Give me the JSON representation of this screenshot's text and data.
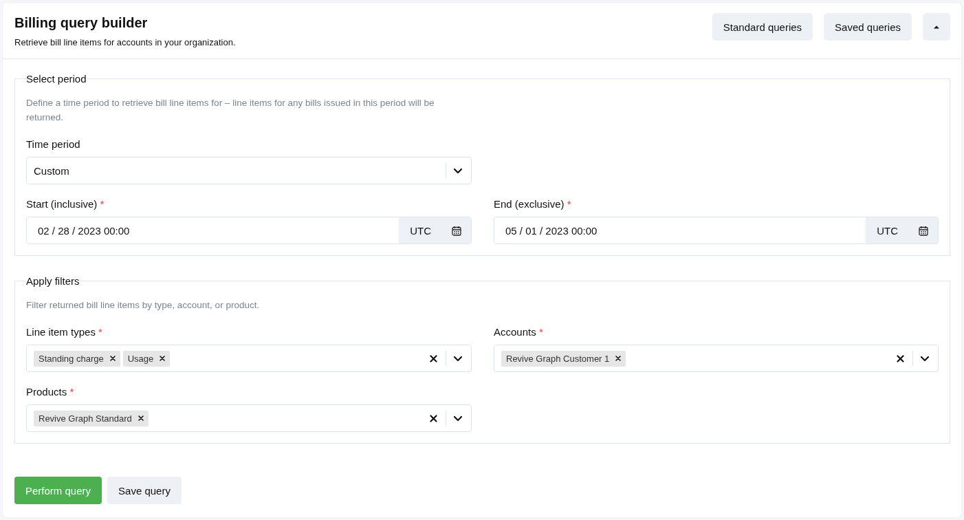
{
  "header": {
    "title": "Billing query builder",
    "subtitle": "Retrieve bill line items for accounts in your organization.",
    "buttons": [
      "Standard queries",
      "Saved queries"
    ]
  },
  "period": {
    "legend": "Select period",
    "description": "Define a time period to retrieve bill line items for – line items for any bills issued in this period will be returned.",
    "time_period": {
      "label": "Time period",
      "value": "Custom"
    },
    "dates": [
      {
        "label": "Start (inclusive)",
        "required_mark": "*",
        "value": "02 / 28 / 2023 00:00",
        "zone": "UTC"
      },
      {
        "label": "End (exclusive)",
        "required_mark": "*",
        "value": "05 / 01 / 2023 00:00",
        "zone": "UTC"
      }
    ]
  },
  "filters": {
    "legend": "Apply filters",
    "description": "Filter returned bill line items by type, account, or product.",
    "fields": [
      {
        "label": "Line item types",
        "required_mark": "*",
        "tags": [
          "Standing charge",
          "Usage"
        ]
      },
      {
        "label": "Accounts",
        "required_mark": "*",
        "tags": [
          "Revive Graph Customer 1"
        ]
      },
      {
        "label": "Products",
        "required_mark": "*",
        "tags": [
          "Revive Graph Standard"
        ]
      }
    ]
  },
  "actions": [
    {
      "label": "Perform query",
      "kind": "primary"
    },
    {
      "label": "Save query",
      "kind": "secondary"
    }
  ]
}
